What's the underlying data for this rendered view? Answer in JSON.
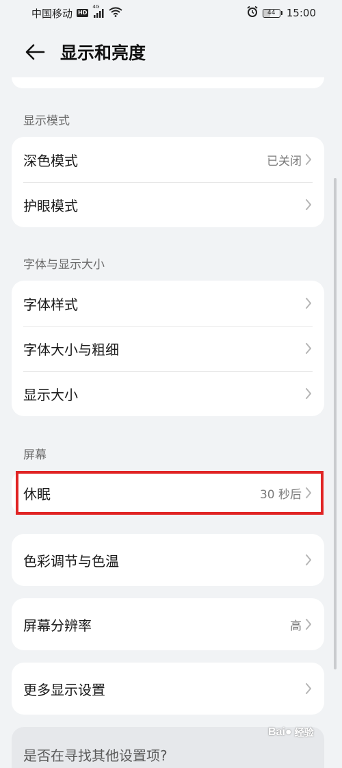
{
  "status_bar": {
    "carrier": "中国移动",
    "hd": "HD",
    "network": "4G",
    "battery": "44",
    "battery_level": 0.44,
    "time": "15:00"
  },
  "header": {
    "title": "显示和亮度"
  },
  "sections": {
    "display_mode": {
      "label": "显示模式",
      "items": [
        {
          "label": "深色模式",
          "value": "已关闭"
        },
        {
          "label": "护眼模式",
          "value": ""
        }
      ]
    },
    "font_display": {
      "label": "字体与显示大小",
      "items": [
        {
          "label": "字体样式"
        },
        {
          "label": "字体大小与粗细"
        },
        {
          "label": "显示大小"
        }
      ]
    },
    "screen": {
      "label": "屏幕",
      "sleep": {
        "label": "休眠",
        "value": "30 秒后"
      },
      "color": {
        "label": "色彩调节与色温"
      },
      "resolution": {
        "label": "屏幕分辨率",
        "value": "高"
      },
      "more": {
        "label": "更多显示设置"
      }
    }
  },
  "bottom": {
    "text": "是否在寻找其他设置项?"
  },
  "watermark": {
    "text": "经验"
  },
  "colors": {
    "background": "#f1f3f5",
    "card": "#ffffff",
    "highlight": "#e02424",
    "secondary_text": "#7a7a7a"
  }
}
